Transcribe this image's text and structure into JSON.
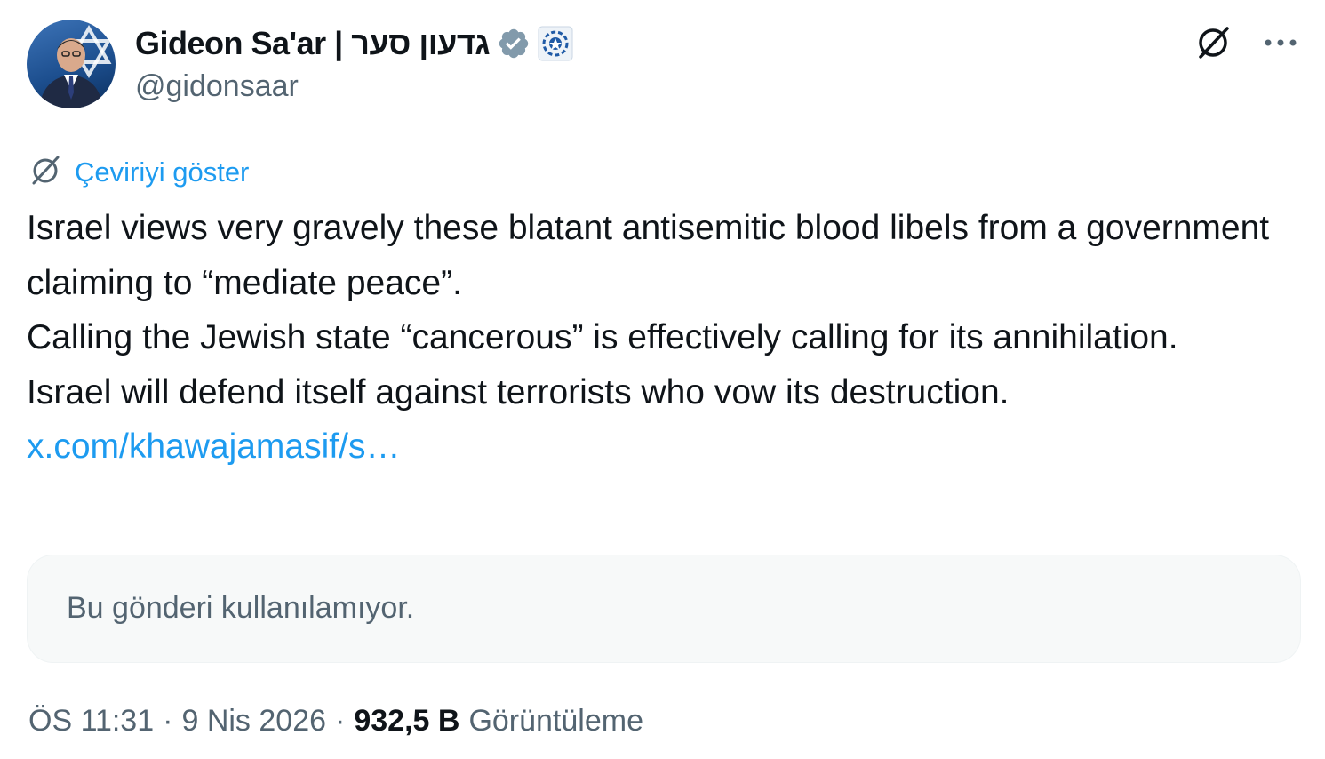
{
  "author": {
    "display_name": "Gideon Sa'ar | גדעון סער",
    "handle": "@gidonsaar"
  },
  "translate": {
    "label": "Çeviriyi göster"
  },
  "tweet": {
    "lines": [
      "Israel views very gravely these blatant antisemitic blood libels from a government claiming to “mediate peace”.",
      "Calling the Jewish state “cancerous” is effectively calling for its annihilation.",
      "Israel will defend itself against terrorists who vow its destruction."
    ],
    "link": "x.com/khawajamasif/s…"
  },
  "quote": {
    "unavailable_text": "Bu gönderi kullanılamıyor."
  },
  "meta": {
    "time": "ÖS 11:31",
    "separator": "·",
    "date": "9 Nis 2026",
    "views_count": "932,5 B",
    "views_label": "Görüntüleme"
  },
  "icons": {
    "verified": "verified-badge-icon",
    "affiliation": "government-affiliation-icon",
    "grok": "grok-icon",
    "more": "more-options-icon",
    "translate": "translate-icon"
  },
  "colors": {
    "link": "#1d9bf0",
    "secondary_text": "#536471",
    "primary_text": "#0f1419",
    "verified_badge": "#829aab",
    "quote_bg": "#f7f9f9"
  }
}
